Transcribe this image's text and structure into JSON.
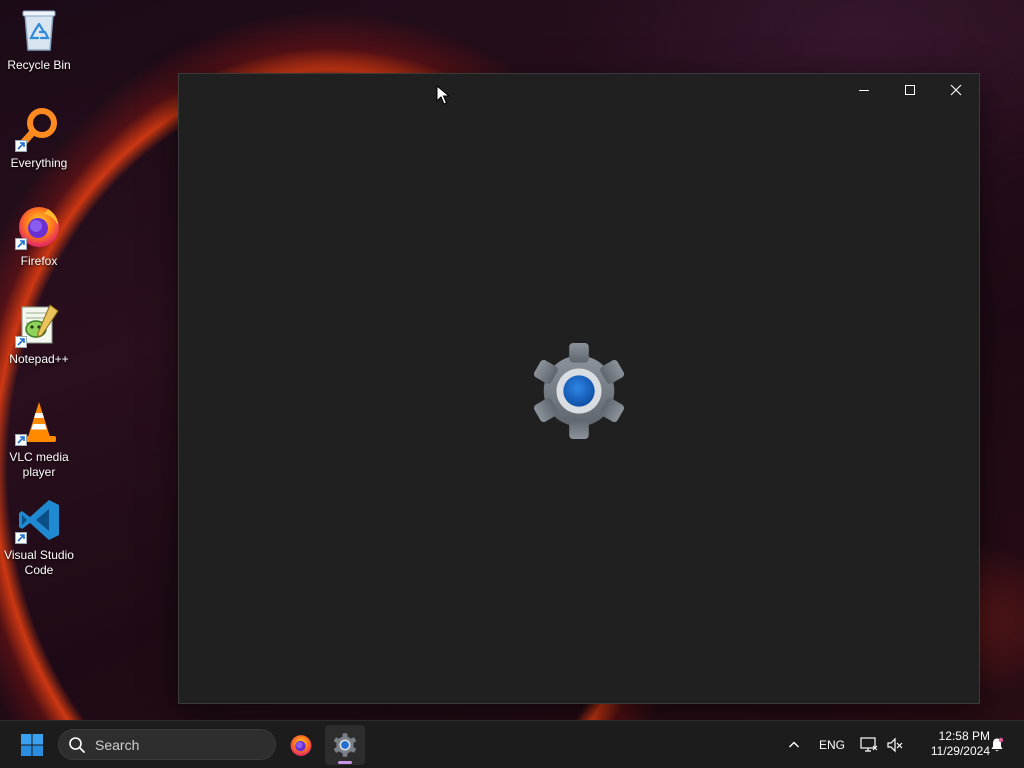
{
  "desktop": {
    "icons": [
      {
        "label": "Recycle Bin",
        "icon": "recycle-bin-icon",
        "shortcut": false
      },
      {
        "label": "Everything",
        "icon": "everything-search-icon",
        "shortcut": true
      },
      {
        "label": "Firefox",
        "icon": "firefox-icon",
        "shortcut": true
      },
      {
        "label": "Notepad++",
        "icon": "notepadpp-icon",
        "shortcut": true
      },
      {
        "label": "VLC media player",
        "icon": "vlc-icon",
        "shortcut": true
      },
      {
        "label": "Visual Studio Code",
        "icon": "vscode-icon",
        "shortcut": true
      }
    ]
  },
  "window": {
    "app": "Settings",
    "state": "loading",
    "splash_icon": "settings-gear-icon",
    "controls": [
      "minimize-icon",
      "maximize-icon",
      "close-icon"
    ]
  },
  "taskbar": {
    "start_icon": "windows-start-icon",
    "search": {
      "placeholder": "Search",
      "icon": "search-icon"
    },
    "pinned_apps": [
      {
        "name": "Firefox",
        "icon": "firefox-icon",
        "active": false
      },
      {
        "name": "Settings",
        "icon": "settings-gear-icon",
        "active": true
      }
    ],
    "tray": {
      "overflow_icon": "chevron-up-icon",
      "language": "ENG",
      "network_icon": "network-icon",
      "volume_icon": "volume-muted-icon",
      "notification_icon": "bell-icon"
    },
    "clock": {
      "time": "12:58 PM",
      "date": "11/29/2024"
    }
  },
  "colors": {
    "window_bg": "#202020",
    "taskbar_bg": "#1c1c1c",
    "accent_gear_center": "#1e6fd0",
    "active_indicator": "#c994e6"
  }
}
